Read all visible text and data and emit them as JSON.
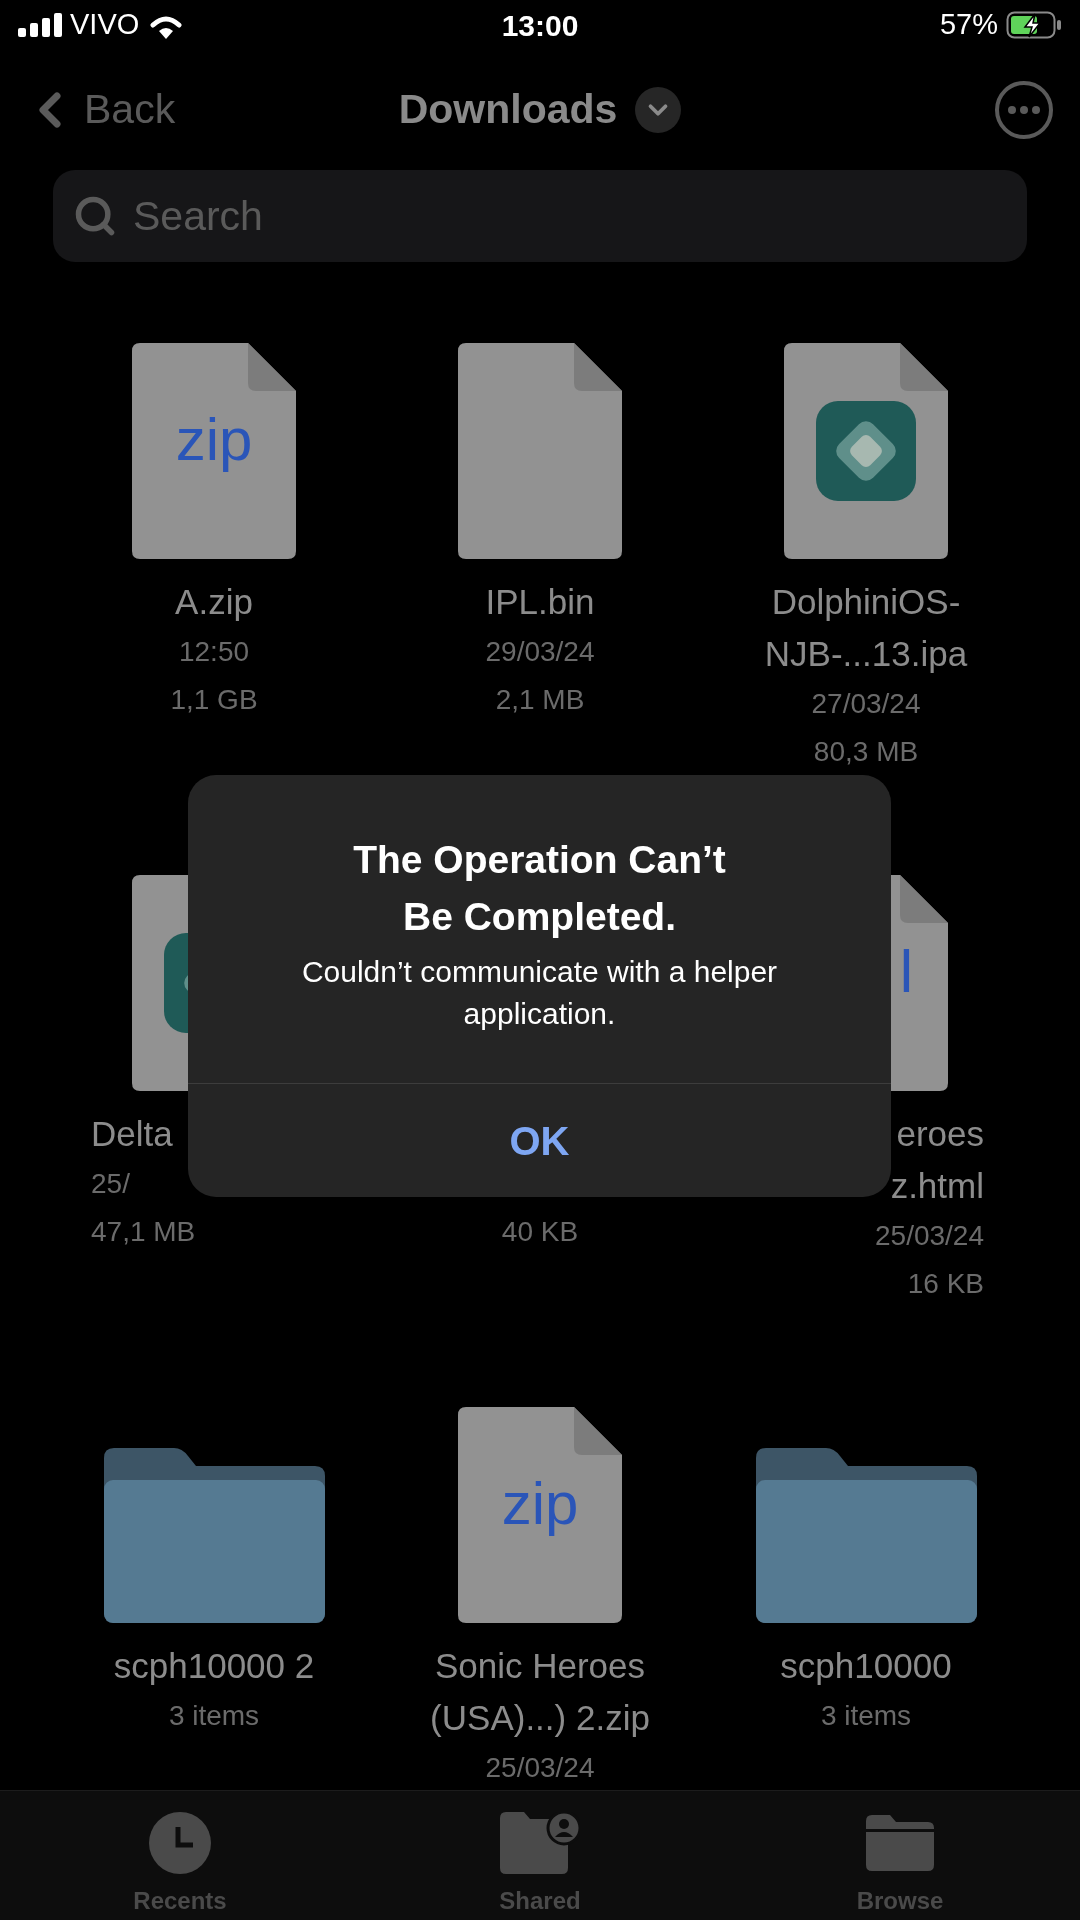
{
  "status_bar": {
    "carrier": "VIVO",
    "time": "13:00",
    "battery": "57%",
    "charging": true
  },
  "nav": {
    "back": "Back",
    "title": "Downloads"
  },
  "search": {
    "placeholder": "Search"
  },
  "files": [
    {
      "kind": "zip",
      "icon_label": "zip",
      "name": [
        "A.zip"
      ],
      "date": "12:50",
      "size": "1,1 GB"
    },
    {
      "kind": "blank",
      "name": [
        "IPL.bin"
      ],
      "date": "29/03/24",
      "size": "2,1 MB"
    },
    {
      "kind": "app",
      "name": [
        "DolphiniOS-",
        "NJB-...13.ipa"
      ],
      "date": "27/03/24",
      "size": "80,3 MB"
    },
    {
      "kind": "app",
      "name": [
        "Delta"
      ],
      "date": "25/",
      "size": "47,1 MB"
    },
    {
      "size": "40 KB"
    },
    {
      "kind": "document",
      "icon_label": "l",
      "name": [
        "eroes",
        "z.html"
      ],
      "date": "25/03/24",
      "size": "16 KB"
    },
    {
      "kind": "folder",
      "name": [
        "scph10000 2"
      ],
      "count": "3 items"
    },
    {
      "kind": "zip",
      "icon_label": "zip",
      "name": [
        "Sonic Heroes",
        "(USA)...) 2.zip"
      ],
      "date": "25/03/24"
    },
    {
      "kind": "folder",
      "name": [
        "scph10000"
      ],
      "count": "3 items"
    }
  ],
  "alert": {
    "title": "The Operation Can’t Be Completed.",
    "message": "Couldn’t communicate with a helper application.",
    "button": "OK"
  },
  "tabs": [
    {
      "label": "Recents",
      "kind": "clock"
    },
    {
      "label": "Shared",
      "kind": "shared-folder"
    },
    {
      "label": "Browse",
      "kind": "folder"
    }
  ]
}
